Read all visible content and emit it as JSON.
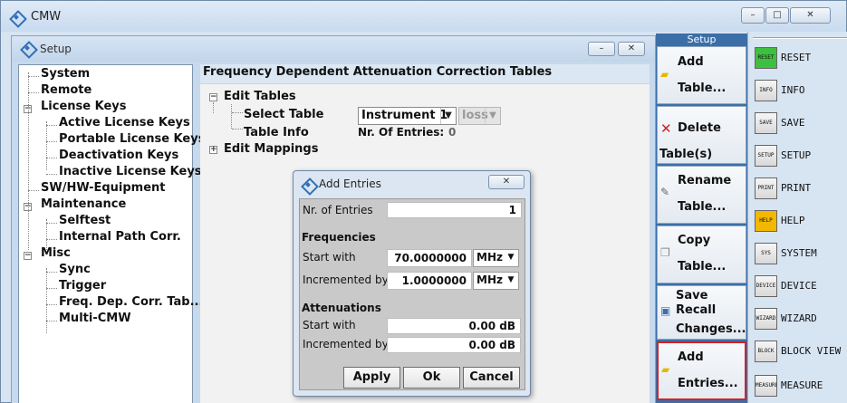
{
  "app": {
    "title": "CMW",
    "window_controls": [
      "–",
      "□",
      "✕"
    ]
  },
  "setup": {
    "title": "Setup",
    "tree": [
      {
        "label": "System",
        "level": 0
      },
      {
        "label": "Remote",
        "level": 0
      },
      {
        "label": "License Keys",
        "level": 0,
        "expandable": true
      },
      {
        "label": "Active License Keys",
        "level": 1
      },
      {
        "label": "Portable License Keys",
        "level": 1
      },
      {
        "label": "Deactivation Keys",
        "level": 1
      },
      {
        "label": "Inactive License Keys",
        "level": 1
      },
      {
        "label": "SW/HW-Equipment",
        "level": 0
      },
      {
        "label": "Maintenance",
        "level": 0,
        "expandable": true
      },
      {
        "label": "Selftest",
        "level": 1
      },
      {
        "label": "Internal Path Corr.",
        "level": 1
      },
      {
        "label": "Misc",
        "level": 0,
        "expandable": true
      },
      {
        "label": "Sync",
        "level": 1
      },
      {
        "label": "Trigger",
        "level": 1
      },
      {
        "label": "Freq. Dep. Corr. Tab...",
        "level": 1
      },
      {
        "label": "Multi-CMW",
        "level": 1
      }
    ],
    "content": {
      "header": "Frequency Dependent Attenuation Correction Tables",
      "edit_tables": "Edit Tables",
      "select_table_label": "Select Table",
      "select_table_value": "Instrument 1",
      "select_table_secondary": "loss",
      "table_info_label": "Table Info",
      "nr_entries_label": "Nr. Of Entries:",
      "nr_entries_value": "0",
      "edit_mappings": "Edit Mappings"
    }
  },
  "dialog": {
    "title": "Add Entries",
    "nr_of_entries_label": "Nr. of Entries",
    "nr_of_entries_value": "1",
    "frequencies_header": "Frequencies",
    "freq_start_label": "Start with",
    "freq_start_value": "70.0000000",
    "freq_start_unit": "MHz",
    "freq_inc_label": "Incremented by",
    "freq_inc_value": "1.0000000",
    "freq_inc_unit": "MHz",
    "attenuations_header": "Attenuations",
    "att_start_label": "Start with",
    "att_start_value": "0.00 dB",
    "att_inc_label": "Incremented by",
    "att_inc_value": "0.00 dB",
    "apply": "Apply",
    "ok": "Ok",
    "cancel": "Cancel"
  },
  "softkeys": {
    "header": "Setup",
    "items": [
      {
        "line1": "Add",
        "line2": "Table..."
      },
      {
        "line1": "Delete",
        "line2": "Table(s)"
      },
      {
        "line1": "Rename",
        "line2": "Table..."
      },
      {
        "line1": "Copy",
        "line2": "Table..."
      },
      {
        "line1": "Save",
        "line2": "Recall",
        "line3": "Changes..."
      },
      {
        "line1": "Add",
        "line2": "Entries..."
      }
    ]
  },
  "hardkeys": [
    {
      "key": "RESET",
      "label": "RESET",
      "color": "#3fbf3f"
    },
    {
      "key": "INFO",
      "label": "INFO"
    },
    {
      "key": "SAVE RCL",
      "label": "SAVE"
    },
    {
      "key": "SETUP",
      "label": "SETUP"
    },
    {
      "key": "PRINT",
      "label": "PRINT"
    },
    {
      "key": "HELP",
      "label": "HELP",
      "color": "#f2b800"
    },
    {
      "key": "SYS",
      "label": "SYSTEM"
    },
    {
      "key": "DEVICE",
      "label": "DEVICE"
    },
    {
      "key": "WIZARD",
      "label": "WIZARD"
    },
    {
      "key": "BLOCK VIEW",
      "label": "BLOCK VIEW"
    },
    {
      "key": "MEASURE",
      "label": "MEASURE"
    }
  ]
}
